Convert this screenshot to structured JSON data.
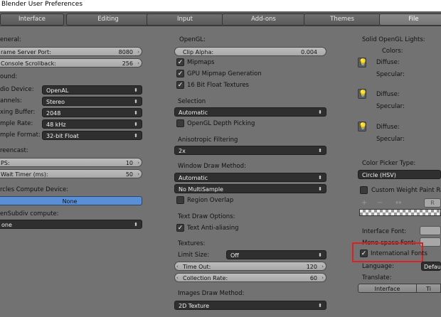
{
  "window": {
    "title": "Blender User Preferences"
  },
  "tabs": [
    "Interface",
    "Editing",
    "Input",
    "Add-ons",
    "Themes",
    "File"
  ],
  "active_tab": "File",
  "col1": {
    "general_heading": "eneral:",
    "frame_server_label": "rame Server Port:",
    "frame_server_value": "8080",
    "console_scrollback_label": "Console Scrollback:",
    "console_scrollback_value": "256",
    "sound_heading": "ound:",
    "audio_device_label": "dio Device:",
    "audio_device_value": "OpenAL",
    "channels_label": "annels:",
    "channels_value": "Stereo",
    "mixing_buffer_label": "xing Buffer:",
    "mixing_buffer_value": "2048",
    "sample_rate_label": "mple Rate:",
    "sample_rate_value": "48 kHz",
    "sample_format_label": "mple Format:",
    "sample_format_value": "32-bit Float",
    "screencast_heading": "reencast:",
    "fps_label": "PS:",
    "fps_value": "10",
    "wait_timer_label": "Wait Timer (ms):",
    "wait_timer_value": "50",
    "circles_heading": "rcles Compute Device:",
    "circles_value": "None",
    "opensubdiv_heading": "enSubdiv compute:",
    "opensubdiv_value": "one"
  },
  "col2": {
    "opengl_heading": "OpenGL:",
    "clip_alpha_label": "Clip Alpha:",
    "clip_alpha_value": "0.004",
    "mipmaps": "Mipmaps",
    "gpu_mipmap": "GPU Mipmap Generation",
    "float_textures": "16 Bit Float Textures",
    "selection_heading": "Selection",
    "selection_value": "Automatic",
    "depth_picking": "OpenGL Depth Picking",
    "aniso_heading": "Anisotropic Filtering",
    "aniso_value": "2x",
    "window_draw_heading": "Window Draw Method:",
    "window_draw_value": "Automatic",
    "multisample_value": "No MultiSample",
    "region_overlap": "Region Overlap",
    "text_draw_heading": "Text Draw Options:",
    "text_aa": "Text Anti-aliasing",
    "textures_heading": "Textures:",
    "limit_size_label": "Limit Size:",
    "limit_size_value": "Off",
    "time_out_label": "Time Out:",
    "time_out_value": "120",
    "collection_rate_label": "Collection Rate:",
    "collection_rate_value": "60",
    "images_draw_heading": "Images Draw Method:",
    "images_draw_value": "2D Texture"
  },
  "col3": {
    "solid_lights_heading": "Solid OpenGL Lights:",
    "colors_label": "Colors:",
    "diffuse_label": "Diffuse:",
    "specular_label": "Specular:",
    "color_picker_heading": "Color Picker Type:",
    "color_picker_value": "Circle (HSV)",
    "custom_weight": "Custom Weight Paint Rang",
    "plus": "+",
    "minus": "−",
    "arrows": "↔",
    "reset_btn": "R",
    "interface_font_label": "Interface Font:",
    "mono_font_label": "Mono-space Font:",
    "intl_fonts": "International Fonts",
    "language_label": "Language:",
    "language_value": "Defaul",
    "translate_label": "Translate:",
    "translate_interface": "Interface",
    "translate_tooltips": "Ti"
  },
  "colors": {
    "highlight": "#e02020",
    "selected_blue": "#5a8fd6",
    "background": "#727272"
  }
}
